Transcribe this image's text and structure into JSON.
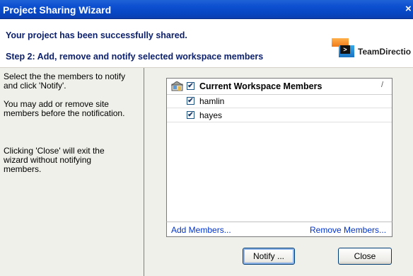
{
  "window": {
    "title": "Project Sharing Wizard",
    "close_glyph": "×"
  },
  "header": {
    "line1": "Your project has been successfully shared.",
    "line2": "Step 2: Add, remove and notify selected workspace members",
    "logo_text": "TeamDirectio",
    "logo_prompt": ">"
  },
  "instructions": [
    "Select the the members to notify and click 'Notify'.",
    "You may add or remove site members before the notification.",
    "Clicking 'Close' will exit the wizard without notifying members."
  ],
  "members_list": {
    "header_label": "Current Workspace Members",
    "header_checked": true,
    "sort_indicator": "/",
    "members": [
      {
        "name": "hamlin",
        "checked": true
      },
      {
        "name": "hayes",
        "checked": true
      }
    ]
  },
  "actions": {
    "add_label": "Add Members...",
    "remove_label": "Remove Members..."
  },
  "buttons": {
    "notify_label": "Notify ...",
    "close_label": "Close"
  },
  "colors": {
    "titlebar": "#0c4fd0",
    "header_text": "#0b1f6b",
    "link": "#0033cc"
  }
}
